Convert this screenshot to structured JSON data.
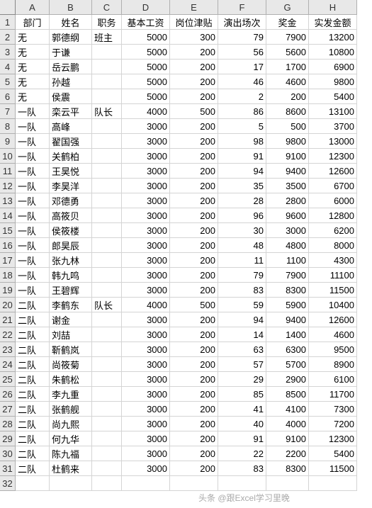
{
  "columns": [
    "A",
    "B",
    "C",
    "D",
    "E",
    "F",
    "G",
    "H"
  ],
  "headers": [
    "部门",
    "姓名",
    "职务",
    "基本工资",
    "岗位津贴",
    "演出场次",
    "奖金",
    "实发金额"
  ],
  "rows": [
    {
      "dept": "无",
      "name": "郭德纲",
      "title": "班主",
      "base": 5000,
      "allow": 300,
      "shows": 79,
      "bonus": 7900,
      "total": 13200
    },
    {
      "dept": "无",
      "name": "于谦",
      "title": "",
      "base": 5000,
      "allow": 200,
      "shows": 56,
      "bonus": 5600,
      "total": 10800
    },
    {
      "dept": "无",
      "name": "岳云鹏",
      "title": "",
      "base": 5000,
      "allow": 200,
      "shows": 17,
      "bonus": 1700,
      "total": 6900
    },
    {
      "dept": "无",
      "name": "孙越",
      "title": "",
      "base": 5000,
      "allow": 200,
      "shows": 46,
      "bonus": 4600,
      "total": 9800
    },
    {
      "dept": "无",
      "name": "侯震",
      "title": "",
      "base": 5000,
      "allow": 200,
      "shows": 2,
      "bonus": 200,
      "total": 5400
    },
    {
      "dept": "一队",
      "name": "栾云平",
      "title": "队长",
      "base": 4000,
      "allow": 500,
      "shows": 86,
      "bonus": 8600,
      "total": 13100
    },
    {
      "dept": "一队",
      "name": "高峰",
      "title": "",
      "base": 3000,
      "allow": 200,
      "shows": 5,
      "bonus": 500,
      "total": 3700
    },
    {
      "dept": "一队",
      "name": "翟国强",
      "title": "",
      "base": 3000,
      "allow": 200,
      "shows": 98,
      "bonus": 9800,
      "total": 13000
    },
    {
      "dept": "一队",
      "name": "关鹤柏",
      "title": "",
      "base": 3000,
      "allow": 200,
      "shows": 91,
      "bonus": 9100,
      "total": 12300
    },
    {
      "dept": "一队",
      "name": "王昊悦",
      "title": "",
      "base": 3000,
      "allow": 200,
      "shows": 94,
      "bonus": 9400,
      "total": 12600
    },
    {
      "dept": "一队",
      "name": "李昊洋",
      "title": "",
      "base": 3000,
      "allow": 200,
      "shows": 35,
      "bonus": 3500,
      "total": 6700
    },
    {
      "dept": "一队",
      "name": "邓德勇",
      "title": "",
      "base": 3000,
      "allow": 200,
      "shows": 28,
      "bonus": 2800,
      "total": 6000
    },
    {
      "dept": "一队",
      "name": "高筱贝",
      "title": "",
      "base": 3000,
      "allow": 200,
      "shows": 96,
      "bonus": 9600,
      "total": 12800
    },
    {
      "dept": "一队",
      "name": "侯筱楼",
      "title": "",
      "base": 3000,
      "allow": 200,
      "shows": 30,
      "bonus": 3000,
      "total": 6200
    },
    {
      "dept": "一队",
      "name": "郎昊辰",
      "title": "",
      "base": 3000,
      "allow": 200,
      "shows": 48,
      "bonus": 4800,
      "total": 8000
    },
    {
      "dept": "一队",
      "name": "张九林",
      "title": "",
      "base": 3000,
      "allow": 200,
      "shows": 11,
      "bonus": 1100,
      "total": 4300
    },
    {
      "dept": "一队",
      "name": "韩九鸣",
      "title": "",
      "base": 3000,
      "allow": 200,
      "shows": 79,
      "bonus": 7900,
      "total": 11100
    },
    {
      "dept": "一队",
      "name": "王碧辉",
      "title": "",
      "base": 3000,
      "allow": 200,
      "shows": 83,
      "bonus": 8300,
      "total": 11500
    },
    {
      "dept": "二队",
      "name": "李鹤东",
      "title": "队长",
      "base": 4000,
      "allow": 500,
      "shows": 59,
      "bonus": 5900,
      "total": 10400
    },
    {
      "dept": "二队",
      "name": "谢金",
      "title": "",
      "base": 3000,
      "allow": 200,
      "shows": 94,
      "bonus": 9400,
      "total": 12600
    },
    {
      "dept": "二队",
      "name": "刘喆",
      "title": "",
      "base": 3000,
      "allow": 200,
      "shows": 14,
      "bonus": 1400,
      "total": 4600
    },
    {
      "dept": "二队",
      "name": "靳鹤岚",
      "title": "",
      "base": 3000,
      "allow": 200,
      "shows": 63,
      "bonus": 6300,
      "total": 9500
    },
    {
      "dept": "二队",
      "name": "尚筱菊",
      "title": "",
      "base": 3000,
      "allow": 200,
      "shows": 57,
      "bonus": 5700,
      "total": 8900
    },
    {
      "dept": "二队",
      "name": "朱鹤松",
      "title": "",
      "base": 3000,
      "allow": 200,
      "shows": 29,
      "bonus": 2900,
      "total": 6100
    },
    {
      "dept": "二队",
      "name": "李九重",
      "title": "",
      "base": 3000,
      "allow": 200,
      "shows": 85,
      "bonus": 8500,
      "total": 11700
    },
    {
      "dept": "二队",
      "name": "张鹤舰",
      "title": "",
      "base": 3000,
      "allow": 200,
      "shows": 41,
      "bonus": 4100,
      "total": 7300
    },
    {
      "dept": "二队",
      "name": "尚九熙",
      "title": "",
      "base": 3000,
      "allow": 200,
      "shows": 40,
      "bonus": 4000,
      "total": 7200
    },
    {
      "dept": "二队",
      "name": "何九华",
      "title": "",
      "base": 3000,
      "allow": 200,
      "shows": 91,
      "bonus": 9100,
      "total": 12300
    },
    {
      "dept": "二队",
      "name": "陈九福",
      "title": "",
      "base": 3000,
      "allow": 200,
      "shows": 22,
      "bonus": 2200,
      "total": 5400
    },
    {
      "dept": "二队",
      "name": "杜鹤来",
      "title": "",
      "base": 3000,
      "allow": 200,
      "shows": 83,
      "bonus": 8300,
      "total": 11500
    }
  ],
  "watermark": "头条 @跟Excel学习里晚"
}
